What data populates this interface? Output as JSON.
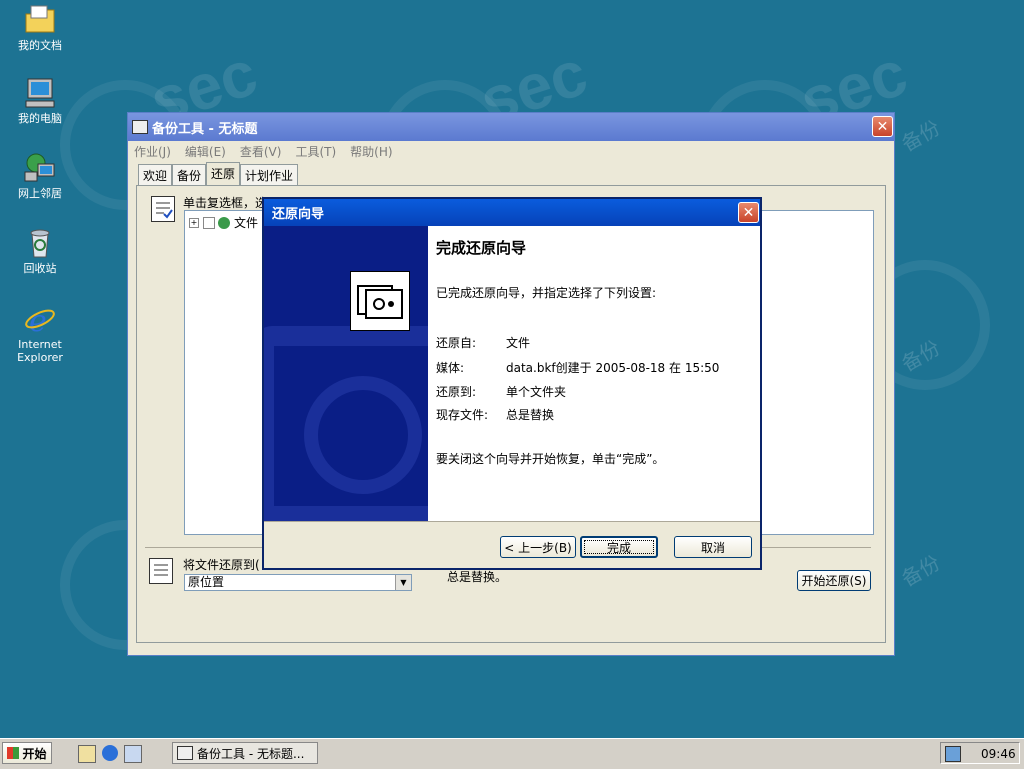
{
  "desktop": {
    "icons": [
      {
        "label": "我的文档"
      },
      {
        "label": "我的电脑"
      },
      {
        "label": "网上邻居"
      },
      {
        "label": "回收站"
      },
      {
        "label": "Internet\nExplorer"
      }
    ]
  },
  "window": {
    "title": "备份工具 - 无标题",
    "menu": [
      "作业(J)",
      "编辑(E)",
      "查看(V)",
      "工具(T)",
      "帮助(H)"
    ],
    "tabs": [
      "欢迎",
      "备份",
      "还原",
      "计划作业"
    ],
    "active_tab": "还原",
    "instruction": "单击复选框，选",
    "tree_item": "文件",
    "restore_to_label": "将文件还原到(",
    "restore_to_value": "原位置",
    "existing_text": "总是替换。",
    "start_button": "开始还原(S)"
  },
  "dialog": {
    "title": "还原向导",
    "heading": "完成还原向导",
    "intro": "已完成还原向导，并指定选择了下列设置:",
    "rows": [
      {
        "key": "还原自:",
        "value": "文件"
      },
      {
        "key": "媒体:",
        "value": "data.bkf创建于 2005-08-18 在 15:50"
      },
      {
        "key": "还原到:",
        "value": "单个文件夹"
      },
      {
        "key": "现存文件:",
        "value": "总是替换"
      }
    ],
    "closing": "要关闭这个向导并开始恢复，单击“完成”。",
    "back_button": "< 上一步(B)",
    "finish_button": "完成",
    "cancel_button": "取消"
  },
  "taskbar": {
    "start": "开始",
    "task": "备份工具 - 无标题...",
    "clock": "09:46"
  },
  "watermark": {
    "logo_text": "sec",
    "cn_text": "备份"
  }
}
